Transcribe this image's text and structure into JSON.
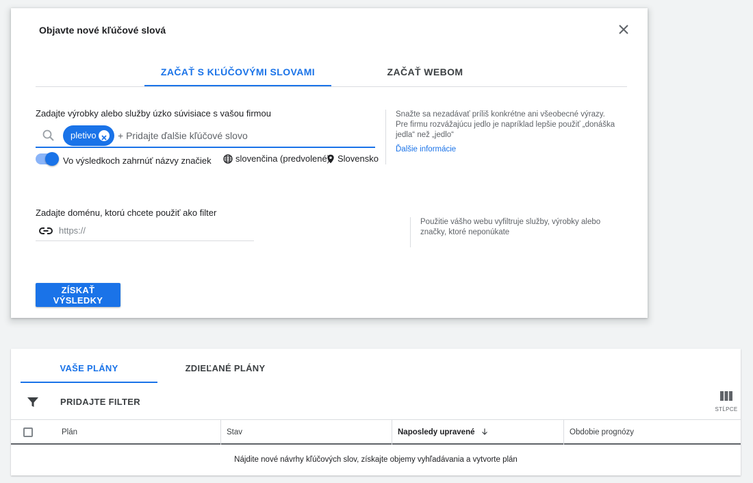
{
  "dialog": {
    "title": "Objavte nové kľúčové slová",
    "tabs": [
      {
        "label": "ZAČAŤ S KĽÚČOVÝMI SLOVAMI",
        "active": true
      },
      {
        "label": "ZAČAŤ WEBOM",
        "active": false
      }
    ],
    "keywords_label": "Zadajte výrobky alebo služby úzko súvisiace s vašou firmou",
    "chips": [
      "pletivo"
    ],
    "add_keyword_placeholder": "+ Pridajte ďalšie kľúčové slovo",
    "brand_toggle_label": "Vo výsledkoch zahrnúť názvy značiek",
    "brand_toggle_on": true,
    "language": "slovenčina (predvolené)",
    "location": "Slovensko",
    "tip_text": "Snažte sa nezadávať príliš konkrétne ani všeobecné výrazy. Pre firmu rozvážajúcu jedlo je napríklad lepšie použiť „donáška jedla“ než „jedlo“",
    "tip_link": "Ďalšie informácie",
    "domain_label": "Zadajte doménu, ktorú chcete použiť ako filter",
    "domain_placeholder": "https://",
    "domain_value": "",
    "domain_tip": "Použitie vášho webu vyfiltruje služby, výrobky alebo značky, ktoré neponúkate",
    "submit_label": "ZÍSKAŤ VÝSLEDKY"
  },
  "plans": {
    "tabs": [
      {
        "label": "VAŠE PLÁNY",
        "active": true
      },
      {
        "label": "ZDIEĽANÉ PLÁNY",
        "active": false
      }
    ],
    "filter_label": "PRIDAJTE FILTER",
    "columns_label": "STĹPCE",
    "table_headers": [
      "Plán",
      "Stav",
      "Naposledy upravené",
      "Obdobie prognózy"
    ],
    "empty_message": "Nájdite nové návrhy kľúčových slov, získajte objemy vyhľadávania a vytvorte plán"
  },
  "colors": {
    "accent": "#1a73e8",
    "background": "#f1f3f4"
  },
  "icons": [
    "close-icon",
    "search-icon",
    "chip-remove-icon",
    "globe-icon",
    "location-pin-icon",
    "link-icon",
    "filter-icon",
    "columns-icon",
    "sort-down-arrow-icon"
  ]
}
